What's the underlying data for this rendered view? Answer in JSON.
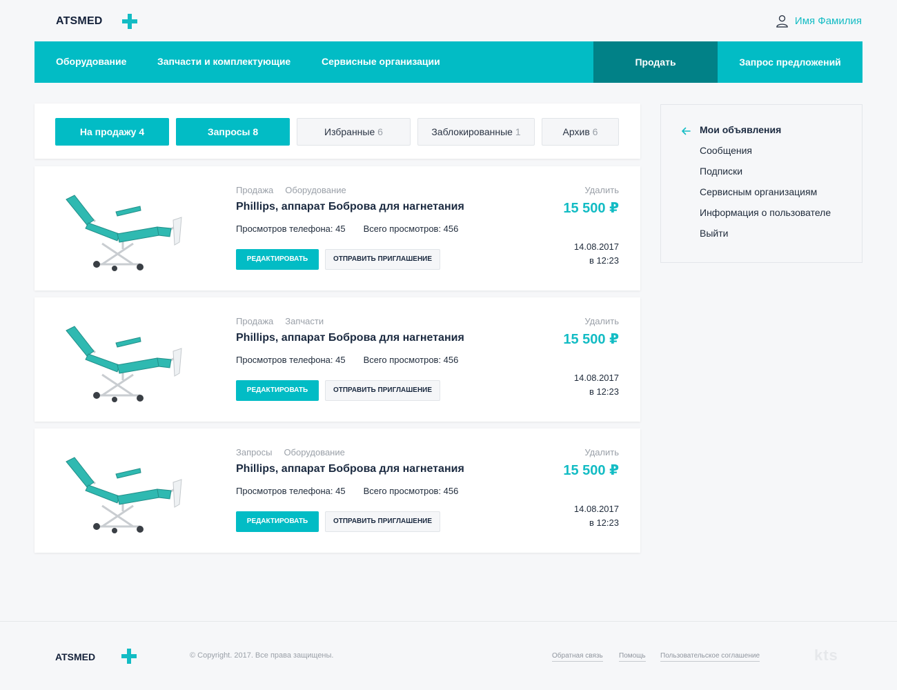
{
  "header": {
    "logo_text": "ATSMED",
    "user_name": "Имя Фамилия"
  },
  "nav": {
    "items": [
      "Оборудование",
      "Запчасти и комплектующие",
      "Сервисные организации"
    ],
    "sell_label": "Продать",
    "request_label": "Запрос предложений"
  },
  "tabs": [
    {
      "label": "На продажу",
      "count": "4",
      "active": true
    },
    {
      "label": "Запросы",
      "count": "8",
      "active": true
    },
    {
      "label": "Избранные",
      "count": "6",
      "active": false
    },
    {
      "label": "Заблокированные",
      "count": "1",
      "active": false
    },
    {
      "label": "Архив",
      "count": "6",
      "active": false
    }
  ],
  "listings": [
    {
      "type": "Продажа",
      "category": "Оборудование",
      "title": "Phillips, аппарат Боброва для нагнетания",
      "phone_views": "Просмотров телефона: 45",
      "total_views": "Всего просмотров: 456",
      "edit_label": "РЕДАКТИРОВАТЬ",
      "invite_label": "ОТПРАВИТЬ ПРИГЛАШЕНИЕ",
      "delete_label": "Удалить",
      "price": "15 500 ₽",
      "date": "14.08.2017",
      "time": "в 12:23"
    },
    {
      "type": "Продажа",
      "category": "Запчасти",
      "title": "Phillips, аппарат Боброва для нагнетания",
      "phone_views": "Просмотров телефона: 45",
      "total_views": "Всего просмотров: 456",
      "edit_label": "РЕДАКТИРОВАТЬ",
      "invite_label": "ОТПРАВИТЬ ПРИГЛАШЕНИЕ",
      "delete_label": "Удалить",
      "price": "15 500 ₽",
      "date": "14.08.2017",
      "time": "в 12:23"
    },
    {
      "type": "Запросы",
      "category": "Оборудование",
      "title": "Phillips, аппарат Боброва для нагнетания",
      "phone_views": "Просмотров телефона: 45",
      "total_views": "Всего просмотров: 456",
      "edit_label": "РЕДАКТИРОВАТЬ",
      "invite_label": "ОТПРАВИТЬ ПРИГЛАШЕНИЕ",
      "delete_label": "Удалить",
      "price": "15 500 ₽",
      "date": "14.08.2017",
      "time": "в 12:23"
    }
  ],
  "sidebar": {
    "items": [
      {
        "label": "Мои объявления",
        "active": true
      },
      {
        "label": "Сообщения",
        "active": false
      },
      {
        "label": "Подписки",
        "active": false
      },
      {
        "label": "Сервисным организациям",
        "active": false
      },
      {
        "label": "Информация о пользователе",
        "active": false
      },
      {
        "label": "Выйти",
        "active": false
      }
    ]
  },
  "footer": {
    "logo_text": "ATSMED",
    "copyright": "© Copyright. 2017. Все права защищены.",
    "links": [
      "Обратная связь",
      "Помощь",
      "Пользовательское соглашение"
    ],
    "brand": "kts"
  },
  "colors": {
    "accent": "#02bcc5",
    "accent_dark": "#018187",
    "price": "#13bcc4"
  }
}
